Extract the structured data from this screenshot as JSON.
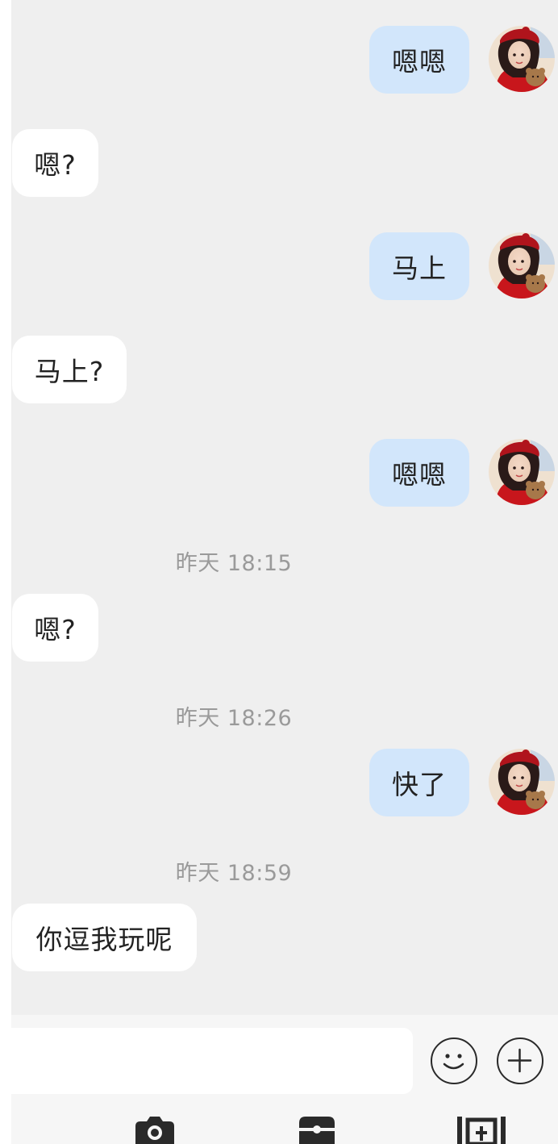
{
  "messages": [
    {
      "side": "out",
      "text": "嗯嗯"
    },
    {
      "side": "in",
      "text": "嗯?"
    },
    {
      "side": "out",
      "text": "马上"
    },
    {
      "side": "in",
      "text": "马上?"
    },
    {
      "side": "out",
      "text": "嗯嗯"
    },
    {
      "type": "time",
      "text": "昨天 18:15"
    },
    {
      "side": "in",
      "text": "嗯?"
    },
    {
      "type": "time",
      "text": "昨天 18:26"
    },
    {
      "side": "out",
      "text": "快了"
    },
    {
      "type": "time",
      "text": "昨天 18:59"
    },
    {
      "side": "in",
      "text": "你逗我玩呢"
    }
  ],
  "input": {
    "value": "",
    "placeholder": ""
  },
  "buttons": {
    "emoji": "smiley-icon",
    "more": "plus-icon"
  },
  "toolbar": [
    "camera-icon",
    "wallet-icon",
    "card-icon"
  ],
  "colors": {
    "chat_bg": "#efefef",
    "outgoing_bubble": "#d2e6fb",
    "incoming_bubble": "#ffffff",
    "timestamp": "#9a9a9a"
  }
}
